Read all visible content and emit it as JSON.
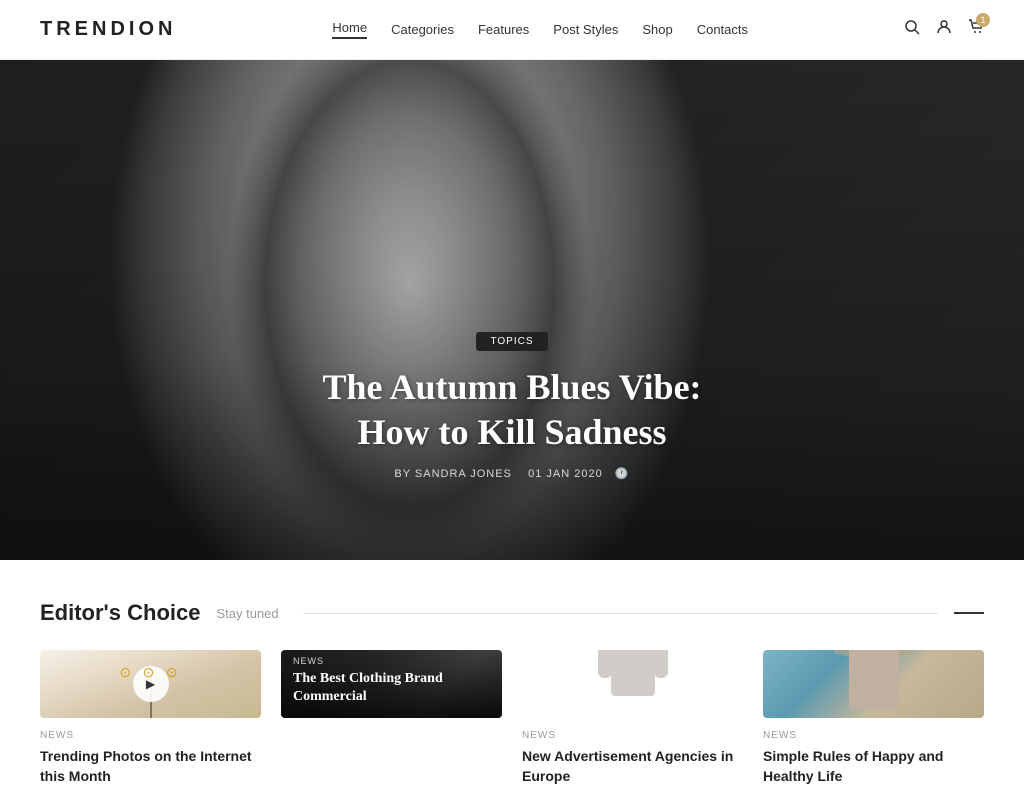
{
  "logo": "TRENDION",
  "nav": {
    "items": [
      {
        "label": "Home",
        "active": true
      },
      {
        "label": "Categories",
        "active": false
      },
      {
        "label": "Features",
        "active": false
      },
      {
        "label": "Post Styles",
        "active": false
      },
      {
        "label": "Shop",
        "active": false
      },
      {
        "label": "Contacts",
        "active": false
      }
    ]
  },
  "cart_count": "1",
  "hero": {
    "badge": "TOPICS",
    "title": "The Autumn Blues Vibe:\nHow to Kill Sadness",
    "author": "BY SANDRA JONES",
    "date": "01 JAN 2020"
  },
  "editors_choice": {
    "title": "Editor's Choice",
    "subtitle": "Stay tuned",
    "cards": [
      {
        "id": 1,
        "has_play": true,
        "category": "NEWS",
        "title": "Trending Photos on the Internet this Month",
        "overlay": false
      },
      {
        "id": 2,
        "has_play": false,
        "category": "NEWS",
        "title": "The Best Clothing Brand Commercial",
        "overlay": true
      },
      {
        "id": 3,
        "has_play": false,
        "category": "NEWS",
        "title": "New Advertisement Agencies in Europe",
        "overlay": false
      },
      {
        "id": 4,
        "has_play": false,
        "category": "NEWS",
        "title": "Simple Rules of Happy and Healthy Life",
        "overlay": false
      }
    ]
  }
}
